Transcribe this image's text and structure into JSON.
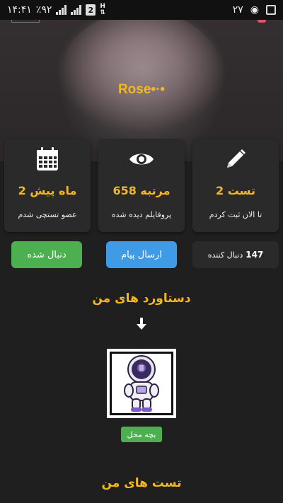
{
  "status_bar": {
    "time": "۱۴:۴۱",
    "battery": "٪۹۲",
    "sim": "2",
    "network": "H",
    "notif_count": "۲۷"
  },
  "profile": {
    "name": "Rose•·•"
  },
  "stats": [
    {
      "value": "2 ماه پیش",
      "label": "عضو تستچی شدم",
      "icon": "calendar-icon"
    },
    {
      "value": "658 مرتبه",
      "label": "پروفایلم دیده شده",
      "icon": "eye-icon"
    },
    {
      "value": "2 تست",
      "label": "تا الان ثبت کردم",
      "icon": "pencil-icon"
    }
  ],
  "actions": {
    "follow_label": "دنبال شده",
    "message_label": "ارسال پیام",
    "followers_count": "147",
    "followers_label": "دنبال کننده"
  },
  "achievements": {
    "title": "دستاورد های من",
    "badge_label": "بچه محل"
  },
  "tests": {
    "title": "تست های من"
  },
  "colors": {
    "accent": "#f5b81c",
    "green": "#4caf50",
    "blue": "#3f9be6",
    "card": "#2a2a2a",
    "background": "#1f1f1f"
  }
}
